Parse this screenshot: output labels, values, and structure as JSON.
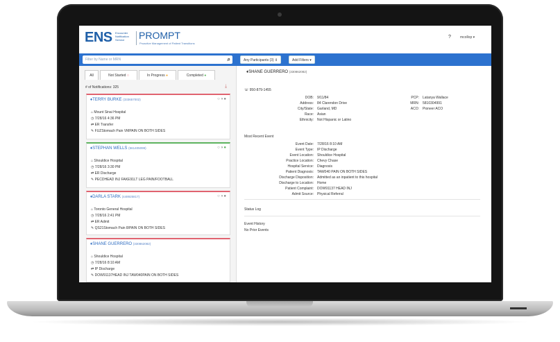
{
  "app": {
    "logo": "ENS",
    "logo_sub": "Encounter Notification Service",
    "product": "PROMPT",
    "product_sub": "Proactive Management of Patient Transitions",
    "help_icon": "help-icon",
    "user_menu": "mcollop"
  },
  "toolbar": {
    "search_placeholder": "Filter by Name or MRN",
    "participants": "Any Participants (3) ⇕",
    "add_filters": "Add Filters ▾"
  },
  "tabs": [
    {
      "label": "All"
    },
    {
      "label": "Not Started"
    },
    {
      "label": "In Progress"
    },
    {
      "label": "Completed"
    }
  ],
  "notifications_count": "# of Notifications: 325",
  "cards": [
    {
      "name": "TERRY BURKE",
      "id": "(333657002)",
      "location": "Mount Sinai Hospital",
      "time": "7/28/16 4:36 PM",
      "event": "ER Transfer",
      "complaint": "FUZStomach Pain VMPAIN ON BOTH SIDES",
      "color": "#e0636f"
    },
    {
      "name": "STEPHAN WELLS",
      "id": "(561405099)",
      "location": "Shouldice Hospital",
      "time": "7/28/16 3:30 PM",
      "event": "ER Discharge",
      "complaint": "PECDHEAD INJ FAKE91LT LEG PAIN/FOOTBALL",
      "color": "#5db35e"
    },
    {
      "name": "DARLA STARK",
      "id": "(448925817)",
      "location": "Toronto General Hospital",
      "time": "7/28/16 2:41 PM",
      "event": "ER Admit",
      "complaint": "QS21Stomach Pain 8/PAIN ON BOTH SIDES",
      "color": "#e0636f"
    },
    {
      "name": "SHANE GUERRERO",
      "id": "(330862082)",
      "location": "Shouldice Hospital",
      "time": "7/28/16 8:10 AM",
      "event": "IP Discharge",
      "complaint": "DOW91137HEAD INJ TAW040PAIN ON BOTH SIDES",
      "color": "#e0636f"
    }
  ],
  "patient": {
    "name": "SHANE GUERRERO",
    "id": "(330862082)",
    "phone": "950-879-1455",
    "dob_label": "DOB:",
    "dob": "9/11/84",
    "address_label": "Address:",
    "address": "84 Clarendon Drive",
    "city_label": "City/State:",
    "city": "Garland, MD",
    "race_label": "Race:",
    "race": "Asian",
    "ethnicity_label": "Ethnicity:",
    "ethnicity": "Not Hispanic or Latino",
    "pcp_label": "PCP:",
    "pcp": "Latanya Wallace",
    "mrn_label": "MRN:",
    "mrn": "5810304991",
    "aco_label": "ACO:",
    "aco": "Pioneer ACO"
  },
  "event": {
    "heading": "Most Recent Event",
    "rows": [
      {
        "label": "Event Date:",
        "value": "7/28/16 8:10 AM"
      },
      {
        "label": "Event Type:",
        "value": "IP Discharge"
      },
      {
        "label": "Event Location:",
        "value": "Shouldice Hospital"
      },
      {
        "label": "Practice Location:",
        "value": "Chevy Chase"
      },
      {
        "label": "Hospital Service:",
        "value": "Diagnosis"
      },
      {
        "label": "Patient Diagnosis:",
        "value": "TAW040 PAIN ON BOTH SIDES"
      },
      {
        "label": "Discharge Disposition:",
        "value": "Admitted as an inpatient to this hospital"
      },
      {
        "label": "Discharge to Location:",
        "value": "Home"
      },
      {
        "label": "Patient Complaint:",
        "value": "DOW91137 HEAD INJ"
      },
      {
        "label": "Admit Source:",
        "value": "Physical Referral"
      }
    ]
  },
  "status_log": "Status Log",
  "event_history": "Event History",
  "no_prior": "No Prior Events"
}
